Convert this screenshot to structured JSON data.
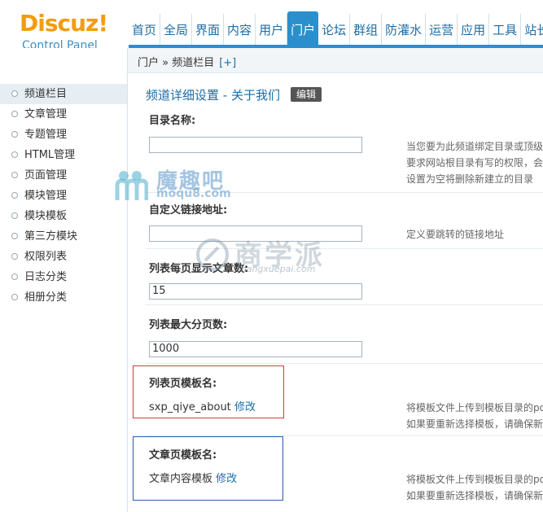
{
  "header": {
    "logo": "Discuz!",
    "logo_sub": "Control Panel",
    "nav": [
      "首页",
      "全局",
      "界面",
      "内容",
      "用户",
      "门户",
      "论坛",
      "群组",
      "防灌水",
      "运营",
      "应用",
      "工具",
      "站长"
    ],
    "active_nav": "门户"
  },
  "breadcrumb": {
    "path": "门户 » 频道栏目",
    "plus": "[+]"
  },
  "sidebar": {
    "items": [
      "频道栏目",
      "文章管理",
      "专题管理",
      "HTML管理",
      "页面管理",
      "模块管理",
      "模块模板",
      "第三方模块",
      "权限列表",
      "日志分类",
      "相册分类"
    ],
    "active": "频道栏目"
  },
  "main": {
    "title": "频道详细设置 - 关于我们",
    "edit_label": "编辑",
    "fields": {
      "dir_label": "目录名称:",
      "dir_value": "",
      "dir_hint_1": "当您要为此频道绑定目录或顶级",
      "dir_hint_2": "要求网站根目录有写的权限，会",
      "dir_hint_3": "设置为空将删除新建立的目录",
      "link_label": "自定义链接地址:",
      "link_value": "",
      "link_hint": "定义要跳转的链接地址",
      "perpage_label": "列表每页显示文章数:",
      "perpage_value": "15",
      "maxpage_label": "列表最大分页数:",
      "maxpage_value": "1000",
      "listtpl_label": "列表页模板名:",
      "listtpl_value": "sxp_qiye_about",
      "listtpl_edit": "修改",
      "listtpl_hint_1": "将模板文件上传到模板目录的po",
      "listtpl_hint_2": "如果要重新选择模板，请确保新",
      "articletpl_label": "文章页模板名:",
      "articletpl_value": "文章内容模板",
      "articletpl_edit": "修改",
      "articletpl_hint_1": "将模板文件上传到模板目录的po",
      "articletpl_hint_2": "如果要重新选择模板，请确保新"
    }
  },
  "watermarks": {
    "wm1_big": "魔趣吧",
    "wm1_small": "moqu8.com",
    "wm2_big": "商学派",
    "wm2_small": "shangxuepai.com"
  },
  "colors": {
    "accent": "#2a8fcc",
    "logo": "#f39c12",
    "link": "#1b6da6",
    "red_box": "#d33c3c",
    "blue_box": "#2b5da8"
  }
}
